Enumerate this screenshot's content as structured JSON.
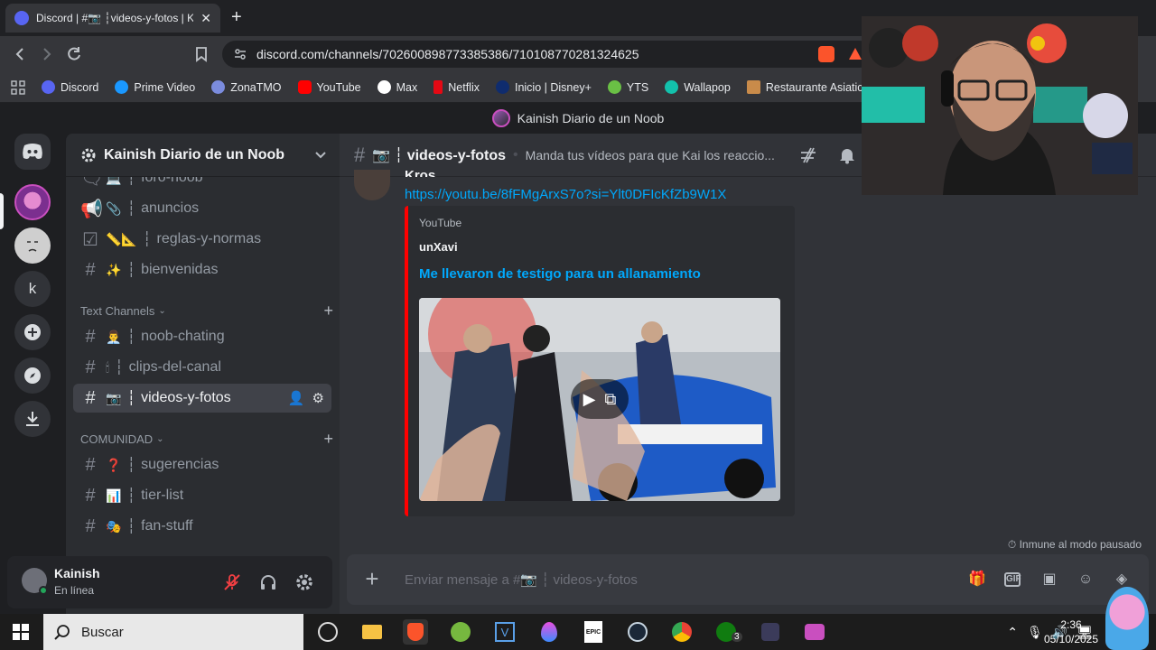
{
  "browser": {
    "tab_title": "Discord | #📷 ┆videos-y-fotos | K",
    "close_glyph": "✕",
    "new_tab_glyph": "+",
    "url": "discord.com/channels/702600898773385386/710108770281324625",
    "bookmarks": [
      {
        "label": "Discord",
        "color": "#5865f2"
      },
      {
        "label": "Prime Video",
        "color": "#1a98ff"
      },
      {
        "label": "ZonaTMO",
        "color": "#7b8cde"
      },
      {
        "label": "YouTube",
        "color": "#ff0000"
      },
      {
        "label": "Max",
        "color": "#ffffff"
      },
      {
        "label": "Netflix",
        "color": "#e50914"
      },
      {
        "label": "Inicio | Disney+",
        "color": "#0f2c6e"
      },
      {
        "label": "YTS",
        "color": "#6ac045"
      },
      {
        "label": "Wallapop",
        "color": "#13c1ac"
      },
      {
        "label": "Restaurante Asiatic...",
        "color": "#c98b4a"
      }
    ]
  },
  "discord": {
    "window_title": "Kainish Diario de un Noob",
    "server_name": "Kainish Diario de un Noob",
    "guild_k": "k",
    "channels_top": [
      {
        "name": "foro-noob",
        "emoji": "💻"
      },
      {
        "name": "anuncios",
        "emoji": "📎"
      },
      {
        "name": "reglas-y-normas",
        "emoji": "📏📐"
      },
      {
        "name": "bienvenidas",
        "emoji": "✨"
      }
    ],
    "categories": {
      "text_channels": "Text Channels",
      "comunidad": "COMUNIDAD"
    },
    "text_channels": [
      {
        "name": "noob-chating",
        "emoji": "👨‍💼"
      },
      {
        "name": "clips-del-canal",
        "emoji": "🕯"
      },
      {
        "name": "videos-y-fotos",
        "emoji": "📷"
      }
    ],
    "comunidad_channels": [
      {
        "name": "sugerencias",
        "emoji": "❓"
      },
      {
        "name": "tier-list",
        "emoji": "📊"
      },
      {
        "name": "fan-stuff",
        "emoji": "🎭"
      }
    ],
    "user": {
      "name": "Kainish",
      "status": "En línea"
    },
    "chat": {
      "channel_name": "📷 ┆ videos-y-fotos",
      "topic": "Manda tus vídeos para que Kai los reaccio...",
      "author": "Kros",
      "link": "https://youtu.be/8fFMgArxS7o?si=Ylt0DFIcKfZb9W1X",
      "embed_provider": "YouTube",
      "embed_author": "unXavi",
      "embed_title": "Me llevaron de testigo para un allanamiento",
      "paused_notice": "Inmune al modo pausado",
      "input_placeholder": "Enviar mensaje a #📷 ┆ videos-y-fotos"
    }
  },
  "taskbar": {
    "search_placeholder": "Buscar",
    "time": "2:36",
    "date": "05/10/2025",
    "xbox_badge": "3"
  },
  "colors": {
    "accent": "#5865f2",
    "online": "#23a55a",
    "link": "#00a8fc",
    "youtube_embed_bar": "#ff0000"
  }
}
